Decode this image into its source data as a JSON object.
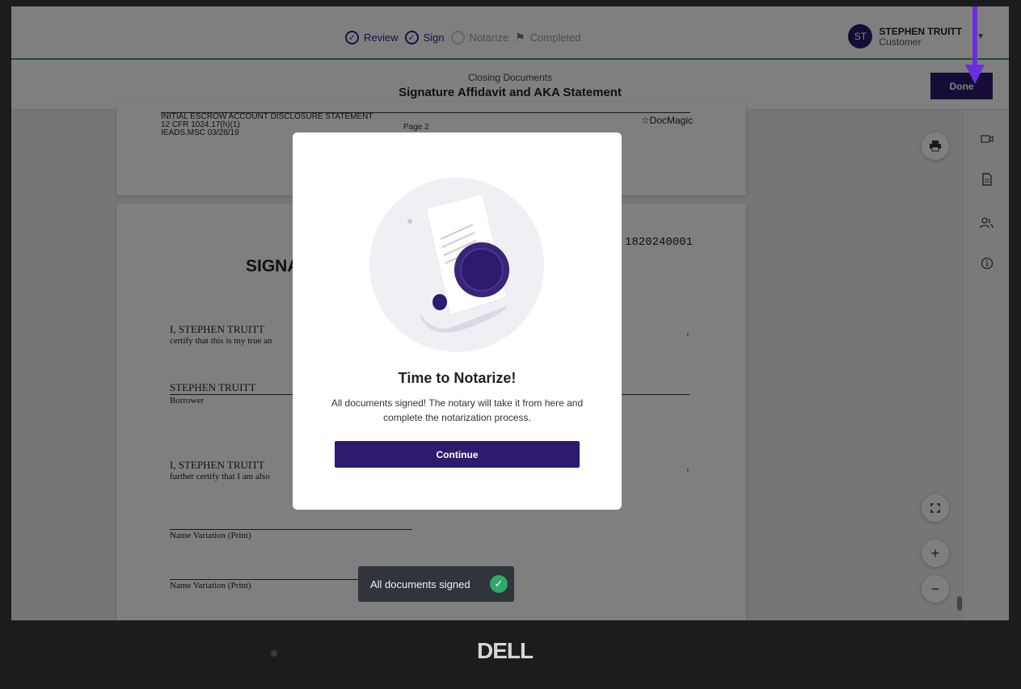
{
  "steps": [
    {
      "label": "Review",
      "state": "done"
    },
    {
      "label": "Sign",
      "state": "done"
    },
    {
      "label": "Notarize",
      "state": "todo"
    },
    {
      "label": "Completed",
      "state": "todo"
    }
  ],
  "user": {
    "initials": "ST",
    "name": "STEPHEN TRUITT",
    "role": "Customer"
  },
  "header": {
    "subtitle": "Closing Documents",
    "title": "Signature Affidavit and AKA Statement",
    "done_label": "Done"
  },
  "document": {
    "page1": {
      "header_lines": [
        "INITIAL ESCROW ACCOUNT DISCLOSURE STATEMENT",
        "12 CFR 1024.17(h)(1)",
        "IEADS.MSC  03/28/19"
      ],
      "page_label": "Page 2",
      "brand": "☆DocMagic"
    },
    "page2": {
      "loan_number": "1820240001",
      "title_partial": "SIGNA",
      "line1": "I,  STEPHEN TRUITT",
      "line2": "certify that this is my true an",
      "signer": "STEPHEN TRUITT",
      "signer_role": "Borrower",
      "line3": "I,  STEPHEN TRUITT",
      "line4": "further certify that I am also",
      "name_var1": "Name Variation (Print)",
      "name_var2": "Name Variation (Print)"
    }
  },
  "modal": {
    "title": "Time to Notarize!",
    "body": "All documents signed! The notary will take it from here and complete the notarization process.",
    "button": "Continue"
  },
  "toast": {
    "text": "All documents signed"
  },
  "device": {
    "brand": "DELL"
  },
  "colors": {
    "accent": "#2d1b6e",
    "success": "#2ea86b",
    "step_line": "#2e9a6a",
    "annotation_arrow": "#6a2ee0"
  }
}
